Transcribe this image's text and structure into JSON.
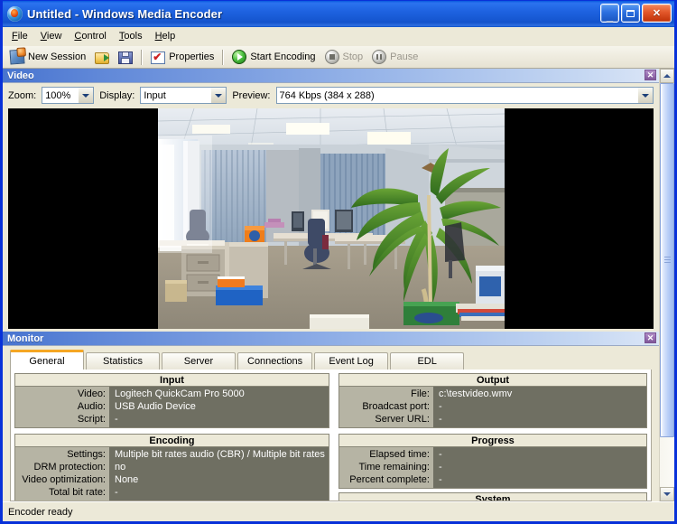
{
  "window": {
    "title": "Untitled - Windows Media Encoder",
    "icon": "encoder-globe-icon",
    "minimize_label": "_",
    "maximize_label": "□",
    "close_label": "✕"
  },
  "menubar": {
    "items": [
      {
        "label": "File",
        "accel": "F"
      },
      {
        "label": "View",
        "accel": "V"
      },
      {
        "label": "Control",
        "accel": "C"
      },
      {
        "label": "Tools",
        "accel": "T"
      },
      {
        "label": "Help",
        "accel": "H"
      }
    ]
  },
  "toolbar": {
    "new_session": "New Session",
    "open_icon": "open-folder-icon",
    "save_icon": "save-floppy-icon",
    "properties": "Properties",
    "start_encoding": "Start Encoding",
    "stop": "Stop",
    "pause": "Pause"
  },
  "video_pane": {
    "title": "Video",
    "close_label": "✕",
    "zoom_label": "Zoom:",
    "zoom_value": "100%",
    "display_label": "Display:",
    "display_value": "Input",
    "preview_label": "Preview:",
    "preview_value": "764 Kbps (384 x 288)"
  },
  "monitor_pane": {
    "title": "Monitor",
    "close_label": "✕",
    "tabs": [
      {
        "label": "General",
        "active": true
      },
      {
        "label": "Statistics",
        "active": false
      },
      {
        "label": "Server",
        "active": false
      },
      {
        "label": "Connections",
        "active": false
      },
      {
        "label": "Event Log",
        "active": false
      },
      {
        "label": "EDL",
        "active": false
      }
    ],
    "sections": {
      "input": {
        "title": "Input",
        "keys": [
          "Video:",
          "Audio:",
          "Script:"
        ],
        "values": [
          "Logitech QuickCam Pro 5000",
          "USB Audio Device",
          "-"
        ]
      },
      "output": {
        "title": "Output",
        "keys": [
          "File:",
          "Broadcast port:",
          "Server URL:"
        ],
        "values": [
          "c:\\testvideo.wmv",
          "-",
          "-"
        ]
      },
      "encoding": {
        "title": "Encoding",
        "keys": [
          "Settings:",
          "DRM protection:",
          "Video optimization:",
          "Total bit rate:"
        ],
        "values": [
          "Multiple bit rates audio (CBR) / Multiple bit rates",
          "no",
          "None",
          "-"
        ]
      },
      "progress": {
        "title": "Progress",
        "keys": [
          "Elapsed time:",
          "Time remaining:",
          "Percent complete:"
        ],
        "values": [
          "-",
          "-",
          "-"
        ]
      },
      "system": {
        "title": "System"
      }
    }
  },
  "scrollbar": {
    "up_label": "▲",
    "down_label": "▼"
  },
  "statusbar": {
    "text": "Encoder ready"
  },
  "colors": {
    "titlebar_blue": "#1e62e0",
    "window_border": "#0831d9",
    "face": "#ece9d8",
    "active_tab_accent": "#f5a623",
    "section_value_bg": "#6f6f62",
    "section_key_bg": "#b6b4a4"
  }
}
